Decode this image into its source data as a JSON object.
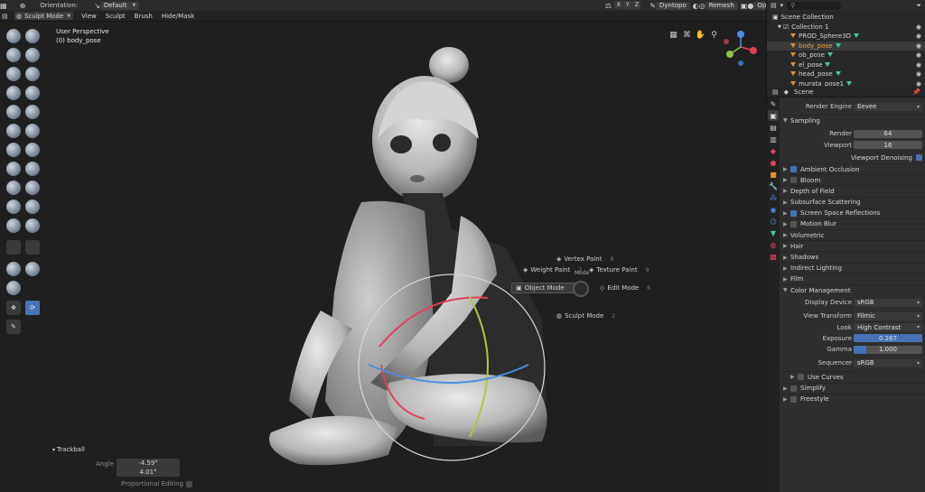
{
  "header": {
    "orientation_label": "Orientation:",
    "orientation_value": "Default",
    "axes": [
      "X",
      "Y",
      "Z"
    ],
    "dyntopo_label": "Dyntopo",
    "remesh_label": "Remesh",
    "options_label": "Options"
  },
  "menubar": {
    "mode": "Sculpt Mode",
    "items": [
      "View",
      "Sculpt",
      "Brush",
      "Hide/Mask"
    ]
  },
  "viewport": {
    "perspective": "User Perspective",
    "object": "(0) body_pose",
    "pie_menu": {
      "vertex_paint": "Vertex Paint",
      "vertex_paint_key": "8",
      "weight_paint": "Weight Paint",
      "weight_paint_key": "7",
      "texture_paint": "Texture Paint",
      "texture_paint_key": "9",
      "object_mode": "Object Mode",
      "object_mode_key": "4",
      "edit_mode": "Edit Mode",
      "edit_mode_key": "6",
      "sculpt_mode": "Sculpt Mode",
      "sculpt_mode_key": "2",
      "mode_label": "Mode"
    },
    "operator": {
      "title": "Trackball",
      "angle_label": "Angle",
      "angle_x": "-4.59°",
      "angle_y": "4.01°",
      "proportional_label": "Proportional Editing"
    }
  },
  "outliner": {
    "search_placeholder": "",
    "root": "Scene Collection",
    "collection": "Collection 1",
    "items": [
      "PROD_Sphere3D",
      "body_pose",
      "ob_pose",
      "el_pose",
      "head_pose",
      "murata_pose1"
    ],
    "selected_index": 1
  },
  "properties": {
    "context": "Scene",
    "render_engine_label": "Render Engine",
    "render_engine": "Eevee",
    "sampling": "Sampling",
    "render_label": "Render",
    "render_samples": "64",
    "viewport_label": "Viewport",
    "viewport_samples": "16",
    "viewport_denoising": "Viewport Denoising",
    "sections": [
      {
        "label": "Ambient Occlusion",
        "checkbox": true,
        "checked": true
      },
      {
        "label": "Bloom",
        "checkbox": true,
        "checked": false
      },
      {
        "label": "Depth of Field",
        "checkbox": false
      },
      {
        "label": "Subsurface Scattering",
        "checkbox": false
      },
      {
        "label": "Screen Space Reflections",
        "checkbox": true,
        "checked": true
      },
      {
        "label": "Motion Blur",
        "checkbox": true,
        "checked": false
      },
      {
        "label": "Volumetric",
        "checkbox": false
      },
      {
        "label": "Hair",
        "checkbox": false
      },
      {
        "label": "Shadows",
        "checkbox": false
      },
      {
        "label": "Indirect Lighting",
        "checkbox": false
      },
      {
        "label": "Film",
        "checkbox": false
      }
    ],
    "color_management": "Color Management",
    "display_device_label": "Display Device",
    "display_device": "sRGB",
    "view_transform_label": "View Transform",
    "view_transform": "Filmic",
    "look_label": "Look",
    "look": "High Contrast",
    "exposure_label": "Exposure",
    "exposure": "0.267",
    "gamma_label": "Gamma",
    "gamma": "1.000",
    "sequencer_label": "Sequencer",
    "sequencer": "sRGB",
    "use_curves": "Use Curves",
    "simplify": "Simplify",
    "freestyle": "Freestyle"
  },
  "colors": {
    "accent": "#4772b3",
    "object_icon": "#e08f3c",
    "mesh_icon": "#46c89a"
  }
}
